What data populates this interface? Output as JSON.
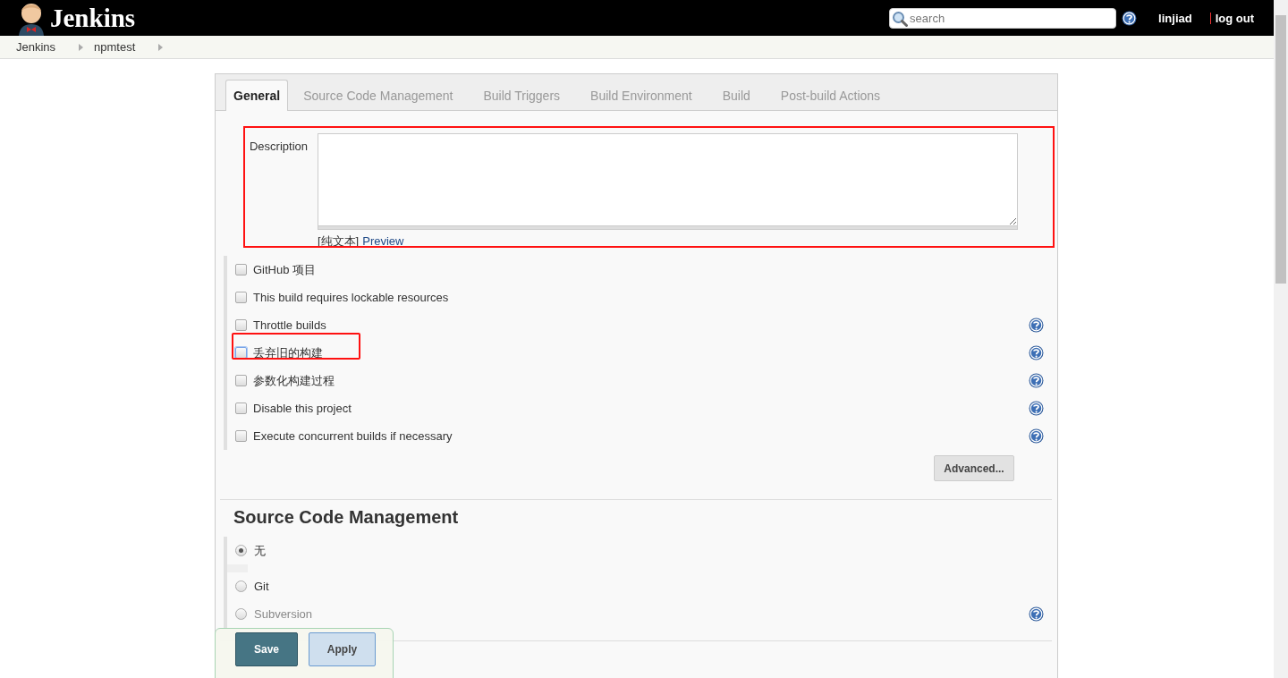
{
  "header": {
    "logo_text": "Jenkins",
    "search": {
      "placeholder": "search"
    },
    "user": "linjiad",
    "logout": "log out"
  },
  "breadcrumbs": [
    "Jenkins",
    "npmtest"
  ],
  "tabs": [
    {
      "label": "General",
      "selected": true
    },
    {
      "label": "Source Code Management",
      "selected": false
    },
    {
      "label": "Build Triggers",
      "selected": false
    },
    {
      "label": "Build Environment",
      "selected": false
    },
    {
      "label": "Build",
      "selected": false
    },
    {
      "label": "Post-build Actions",
      "selected": false
    }
  ],
  "description": {
    "label": "Description",
    "format": "[纯文本]",
    "preview_link": "Preview",
    "highlighted": true
  },
  "options": [
    {
      "label": "GitHub 项目",
      "checked": false,
      "help": false,
      "focused": false,
      "highlighted": false
    },
    {
      "label": "This build requires lockable resources",
      "checked": false,
      "help": false,
      "focused": false,
      "highlighted": false
    },
    {
      "label": "Throttle builds",
      "checked": false,
      "help": true,
      "focused": false,
      "highlighted": false
    },
    {
      "label": "丢弃旧的构建",
      "checked": false,
      "help": true,
      "focused": true,
      "highlighted": true
    },
    {
      "label": "参数化构建过程",
      "checked": false,
      "help": true,
      "focused": false,
      "highlighted": false
    },
    {
      "label": "Disable this project",
      "checked": false,
      "help": true,
      "focused": false,
      "highlighted": false
    },
    {
      "label": "Execute concurrent builds if necessary",
      "checked": false,
      "help": true,
      "focused": false,
      "highlighted": false
    }
  ],
  "advanced_button": "Advanced...",
  "scm": {
    "heading": "Source Code Management",
    "options": [
      {
        "label": "无",
        "selected": true,
        "help": false
      },
      {
        "label": "Git",
        "selected": false,
        "help": false
      },
      {
        "label": "Subversion",
        "selected": false,
        "help": true
      }
    ]
  },
  "buttons": [
    {
      "label": "Save",
      "kind": "primary"
    },
    {
      "label": "Apply",
      "kind": "secondary"
    }
  ]
}
